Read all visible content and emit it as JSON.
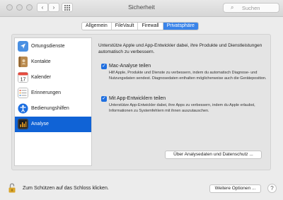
{
  "window": {
    "title": "Sicherheit",
    "back_glyph": "‹",
    "forward_glyph": "›",
    "search_placeholder": "Suchen"
  },
  "tabs": [
    {
      "label": "Allgemein",
      "active": false
    },
    {
      "label": "FileVault",
      "active": false
    },
    {
      "label": "Firewall",
      "active": false
    },
    {
      "label": "Privatsphäre",
      "active": true
    }
  ],
  "sidebar": {
    "items": [
      {
        "label": "Ortungsdienste",
        "icon": "location-arrow-icon",
        "color": "#4a90e2",
        "selected": false
      },
      {
        "label": "Kontakte",
        "icon": "contacts-book-icon",
        "color": "#b98a4e",
        "selected": false
      },
      {
        "label": "Kalender",
        "icon": "calendar-icon",
        "color": "#ffffff",
        "selected": false
      },
      {
        "label": "Erinnerungen",
        "icon": "reminders-list-icon",
        "color": "#ffffff",
        "selected": false
      },
      {
        "label": "Bedienungshilfen",
        "icon": "accessibility-icon",
        "color": "#1c6ee0",
        "selected": false
      },
      {
        "label": "Analyse",
        "icon": "analytics-chart-icon",
        "color": "#3a3a3a",
        "selected": true
      }
    ]
  },
  "content": {
    "intro": "Unterstütze Apple und App-Entwickler dabei, ihre Produkte und Dienstleistungen automatisch zu verbessern.",
    "option1": {
      "label": "Mac-Analyse teilen",
      "checked": true,
      "description": "Hilf Apple, Produkte und Dienste zu verbessern, indem du automatisch Diagnose- und Nutzungsdaten sendest. Diagnosedaten enthalten möglicherweise auch die Geräteposition."
    },
    "option2": {
      "label": "Mit App-Entwicklern teilen",
      "checked": true,
      "description": "Unterstütze App-Entwickler dabei, ihre Apps zu verbessern, indem du Apple erlaubst, Informationen zu Systemfehlern mit ihnen auszutauschen."
    },
    "about_button": "Über Analysedaten und Datenschutz ..."
  },
  "footer": {
    "lock_text": "Zum Schützen auf das Schloss klicken.",
    "advanced_button": "Weitere Optionen ...",
    "help_glyph": "?"
  },
  "colors": {
    "accent": "#3a84e9",
    "selection": "#1063d6",
    "lock": "#d9a52b"
  }
}
